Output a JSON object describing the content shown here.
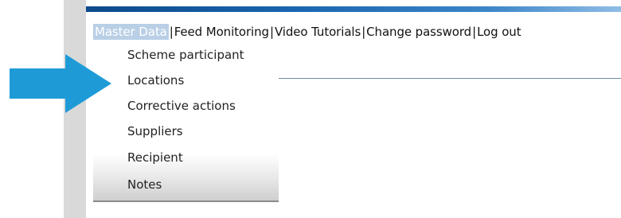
{
  "nav": {
    "items": [
      {
        "label": "Master Data",
        "active": true
      },
      {
        "label": "Feed Monitoring",
        "active": false
      },
      {
        "label": "Video Tutorials",
        "active": false
      },
      {
        "label": "Change password",
        "active": false
      },
      {
        "label": "Log out",
        "active": false
      }
    ],
    "separator": "|"
  },
  "dropdown": {
    "items": [
      {
        "label": "Scheme participant"
      },
      {
        "label": "Locations"
      },
      {
        "label": "Corrective actions"
      },
      {
        "label": "Suppliers"
      },
      {
        "label": "Recipient"
      },
      {
        "label": "Notes"
      }
    ]
  },
  "annotation": {
    "icon": "arrow-right-icon",
    "color": "#1e9bd7",
    "points_to": "Locations"
  },
  "colors": {
    "header_band_start": "#0b4a8b",
    "header_band_end": "#8fbde6",
    "active_nav_bg": "#b9cfe6",
    "left_bar": "#d9d9d9"
  }
}
